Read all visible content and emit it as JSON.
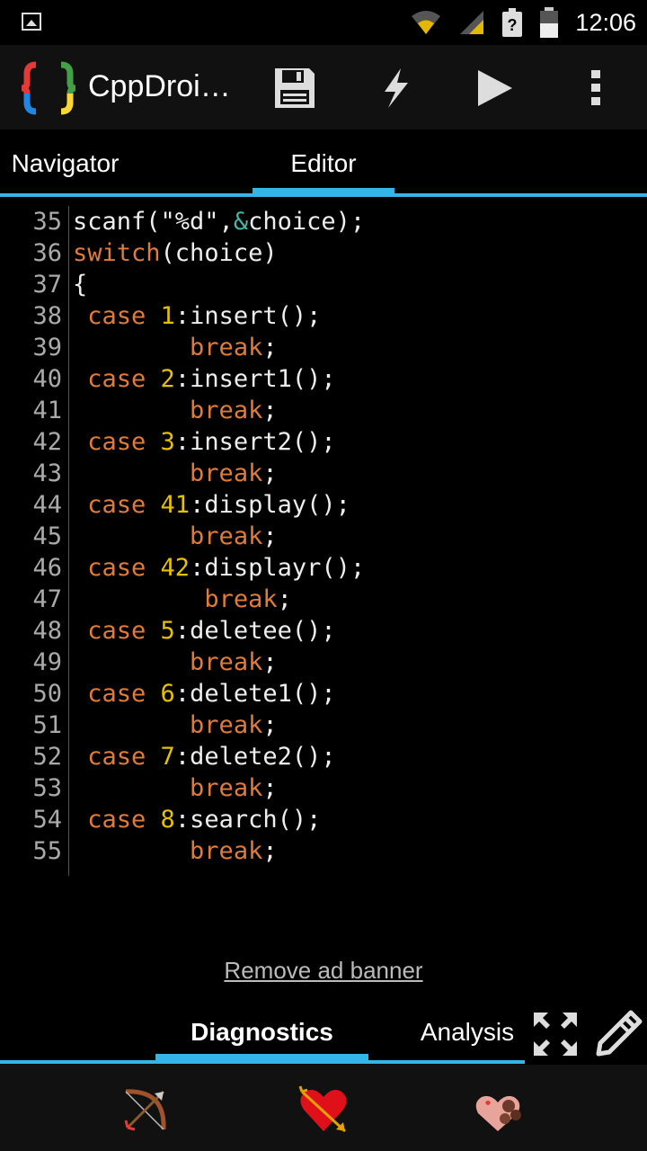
{
  "status_bar": {
    "time": "12:06",
    "icons": [
      "image-icon",
      "wifi-icon",
      "signal-icon",
      "battery-unknown-icon"
    ]
  },
  "app_bar": {
    "title": "CppDroi…",
    "actions": [
      "save-icon",
      "flash-icon",
      "run-icon",
      "overflow-menu-icon"
    ]
  },
  "tabs": [
    {
      "label": "Navigator",
      "selected": false
    },
    {
      "label": "Editor",
      "selected": true
    }
  ],
  "code_lines": [
    {
      "num": "35",
      "indent": "",
      "tokens": [
        [
          "t",
          "scanf(\"%d\","
        ],
        [
          "a",
          "&"
        ],
        [
          "t",
          "choice);"
        ]
      ]
    },
    {
      "num": "36",
      "indent": "",
      "tokens": [
        [
          "k",
          "switch"
        ],
        [
          "t",
          "(choice)"
        ]
      ]
    },
    {
      "num": "37",
      "indent": "",
      "tokens": [
        [
          "t",
          "{"
        ]
      ]
    },
    {
      "num": "38",
      "indent": " ",
      "tokens": [
        [
          "k",
          "case "
        ],
        [
          "n",
          "1"
        ],
        [
          "t",
          ":insert();"
        ]
      ]
    },
    {
      "num": "39",
      "indent": "        ",
      "tokens": [
        [
          "k",
          "break"
        ],
        [
          "t",
          ";"
        ]
      ]
    },
    {
      "num": "40",
      "indent": " ",
      "tokens": [
        [
          "k",
          "case "
        ],
        [
          "n",
          "2"
        ],
        [
          "t",
          ":insert1();"
        ]
      ]
    },
    {
      "num": "41",
      "indent": "        ",
      "tokens": [
        [
          "k",
          "break"
        ],
        [
          "t",
          ";"
        ]
      ]
    },
    {
      "num": "42",
      "indent": " ",
      "tokens": [
        [
          "k",
          "case "
        ],
        [
          "n",
          "3"
        ],
        [
          "t",
          ":insert2();"
        ]
      ]
    },
    {
      "num": "43",
      "indent": "        ",
      "tokens": [
        [
          "k",
          "break"
        ],
        [
          "t",
          ";"
        ]
      ]
    },
    {
      "num": "44",
      "indent": " ",
      "tokens": [
        [
          "k",
          "case "
        ],
        [
          "n",
          "41"
        ],
        [
          "t",
          ":display();"
        ]
      ]
    },
    {
      "num": "45",
      "indent": "        ",
      "tokens": [
        [
          "k",
          "break"
        ],
        [
          "t",
          ";"
        ]
      ]
    },
    {
      "num": "46",
      "indent": " ",
      "tokens": [
        [
          "k",
          "case "
        ],
        [
          "n",
          "42"
        ],
        [
          "t",
          ":displayr();"
        ]
      ]
    },
    {
      "num": "47",
      "indent": "         ",
      "tokens": [
        [
          "k",
          "break"
        ],
        [
          "t",
          ";"
        ]
      ]
    },
    {
      "num": "48",
      "indent": " ",
      "tokens": [
        [
          "k",
          "case "
        ],
        [
          "n",
          "5"
        ],
        [
          "t",
          ":deletee();"
        ]
      ]
    },
    {
      "num": "49",
      "indent": "        ",
      "tokens": [
        [
          "k",
          "break"
        ],
        [
          "t",
          ";"
        ]
      ]
    },
    {
      "num": "50",
      "indent": " ",
      "tokens": [
        [
          "k",
          "case "
        ],
        [
          "n",
          "6"
        ],
        [
          "t",
          ":delete1();"
        ]
      ]
    },
    {
      "num": "51",
      "indent": "        ",
      "tokens": [
        [
          "k",
          "break"
        ],
        [
          "t",
          ";"
        ]
      ]
    },
    {
      "num": "52",
      "indent": " ",
      "tokens": [
        [
          "k",
          "case "
        ],
        [
          "n",
          "7"
        ],
        [
          "t",
          ":delete2();"
        ]
      ]
    },
    {
      "num": "53",
      "indent": "        ",
      "tokens": [
        [
          "k",
          "break"
        ],
        [
          "t",
          ";"
        ]
      ]
    },
    {
      "num": "54",
      "indent": " ",
      "tokens": [
        [
          "k",
          "case "
        ],
        [
          "n",
          "8"
        ],
        [
          "t",
          ":search();"
        ]
      ]
    },
    {
      "num": "55",
      "indent": "        ",
      "tokens": [
        [
          "k",
          "break"
        ],
        [
          "t",
          ";"
        ]
      ]
    }
  ],
  "ad": {
    "link_text": "Remove ad banner"
  },
  "bottom_tabs": [
    {
      "label": "Diagnostics",
      "selected": true
    },
    {
      "label": "Analysis",
      "selected": false
    }
  ],
  "bottom_actions": [
    "expand-icon",
    "edit-icon"
  ],
  "bottom_nav": [
    "cupid-bow-icon",
    "heart-arrow-icon",
    "chocolate-box-icon"
  ],
  "colors": {
    "accent": "#33b5e5",
    "keyword": "#e07b39",
    "number": "#e5c100",
    "operator": "#3fb8a6"
  }
}
